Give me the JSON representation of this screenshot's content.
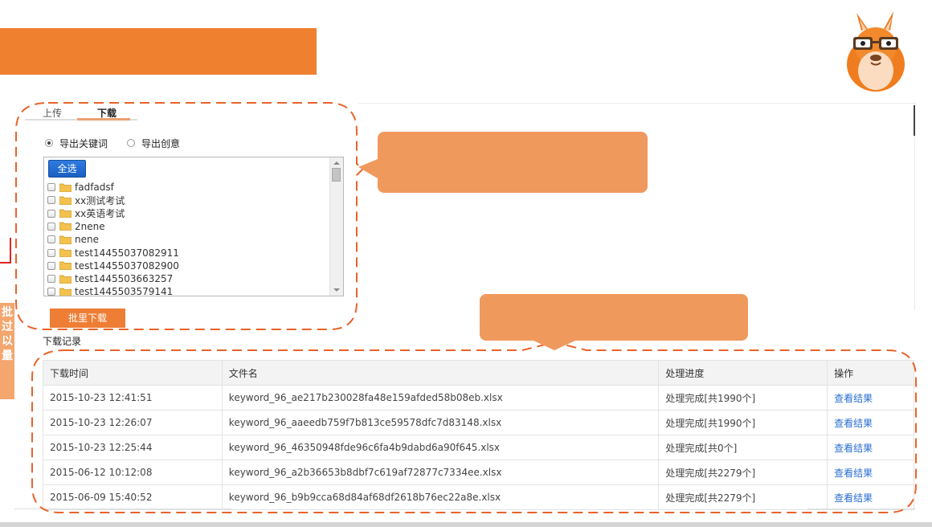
{
  "tabs": {
    "upload": "上传",
    "download": "下载"
  },
  "export_options": [
    {
      "label": "导出关键词",
      "selected": true
    },
    {
      "label": "导出创意",
      "selected": false
    }
  ],
  "tree": {
    "select_all": "全选",
    "items": [
      "fadfadsf",
      "xx测试考试",
      "xx英语考试",
      "2nene",
      "nene",
      "test14455037082911",
      "test14455037082900",
      "test1445503663257",
      "test1445503579141"
    ]
  },
  "batch_download": "批里下载",
  "left_strip": [
    "批",
    "过",
    "以",
    "量"
  ],
  "records": {
    "title": "下载记录",
    "columns": [
      "下载时间",
      "文件名",
      "处理进度",
      "操作"
    ],
    "rows": [
      [
        "2015-10-23 12:41:51",
        "keyword_96_ae217b230028fa48e159afded58b08eb.xlsx",
        "处理完成[共1990个]",
        "查看结果"
      ],
      [
        "2015-10-23 12:26:07",
        "keyword_96_aaeedb759f7b813ce59578dfc7d83148.xlsx",
        "处理完成[共1990个]",
        "查看结果"
      ],
      [
        "2015-10-23 12:25:44",
        "keyword_96_46350948fde96c6fa4b9dabd6a90f645.xlsx",
        "处理完成[共0个]",
        "查看结果"
      ],
      [
        "2015-06-12 10:12:08",
        "keyword_96_a2b36653b8dbf7c619af72877c7334ee.xlsx",
        "处理完成[共2279个]",
        "查看结果"
      ],
      [
        "2015-06-09 15:40:52",
        "keyword_96_b9b9cca68d84af68df2618b76ec22a8e.xlsx",
        "处理完成[共2279个]",
        "查看结果"
      ]
    ]
  },
  "colors": {
    "accent": "#ee8030",
    "callout": "#f0995d",
    "dash": "#e8632a",
    "link": "#2a6ecf",
    "select_all": "#1b5fc4"
  },
  "icons": {
    "mascot": "llama-mascot-icon",
    "folder": "folder-icon"
  }
}
